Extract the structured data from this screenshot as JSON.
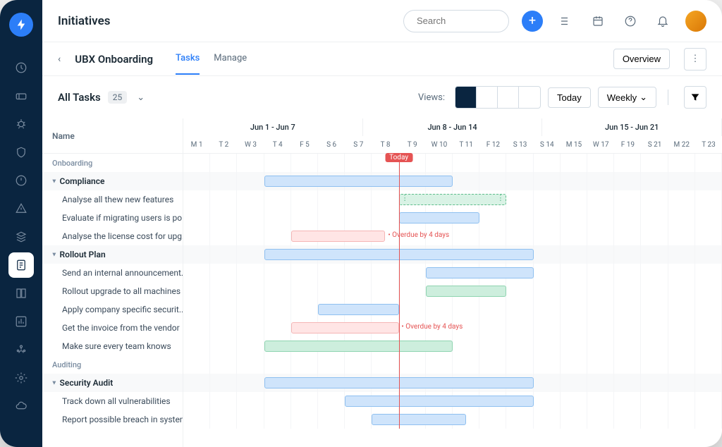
{
  "header": {
    "title": "Initiatives",
    "search_placeholder": "Search"
  },
  "breadcrumb": {
    "project": "UBX Onboarding",
    "tabs": [
      "Tasks",
      "Manage"
    ],
    "active_tab": 0,
    "overview_label": "Overview"
  },
  "toolbar": {
    "all_tasks_label": "All Tasks",
    "count": "25",
    "views_label": "Views:",
    "today_label": "Today",
    "weekly_label": "Weekly"
  },
  "columns": {
    "name": "Name"
  },
  "timeline": {
    "weeks": [
      "Jun 1 - Jun 7",
      "Jun 8 - Jun 14",
      "Jun 15 - Jun 21"
    ],
    "days": [
      "M 1",
      "T 2",
      "W 3",
      "T 4",
      "F 5",
      "S 6",
      "S 7",
      "T 8",
      "T 9",
      "W 10",
      "T 11",
      "F 12",
      "S 13",
      "S 14",
      "M 15",
      "W 17",
      "F 19",
      "S 21",
      "M 22",
      "T 23"
    ],
    "today_label": "Today",
    "today_index": 8
  },
  "sections": [
    {
      "name": "Onboarding",
      "groups": [
        {
          "name": "Compliance",
          "bar": {
            "start": 3,
            "span": 7,
            "type": "blue"
          },
          "tasks": [
            {
              "name": "Analyse all thew new features",
              "bar": {
                "start": 8,
                "span": 4,
                "type": "green-dash"
              }
            },
            {
              "name": "Evaluate if migrating users is po...",
              "bar": {
                "start": 8,
                "span": 3,
                "type": "blue"
              }
            },
            {
              "name": "Analyse the license cost for upg...",
              "bar": {
                "start": 4,
                "span": 3.5,
                "type": "red"
              },
              "overdue": "Overdue by 4 days"
            }
          ]
        },
        {
          "name": "Rollout Plan",
          "bar": {
            "start": 3,
            "span": 10,
            "type": "blue"
          },
          "tasks": [
            {
              "name": "Send an internal announcement...",
              "bar": {
                "start": 9,
                "span": 4,
                "type": "blue"
              }
            },
            {
              "name": "Rollout upgrade to all machines",
              "bar": {
                "start": 9,
                "span": 3,
                "type": "green"
              }
            },
            {
              "name": "Apply company specific securit...",
              "bar": {
                "start": 5,
                "span": 3,
                "type": "blue"
              }
            },
            {
              "name": "Get the invoice from the vendor",
              "bar": {
                "start": 4,
                "span": 4,
                "type": "red"
              },
              "overdue": "Overdue by 4 days"
            },
            {
              "name": "Make sure every team knows",
              "bar": {
                "start": 3,
                "span": 7,
                "type": "green"
              }
            }
          ]
        }
      ]
    },
    {
      "name": "Auditing",
      "groups": [
        {
          "name": "Security Audit",
          "bar": {
            "start": 3,
            "span": 10,
            "type": "blue"
          },
          "tasks": [
            {
              "name": "Track down all vulnerabilities",
              "bar": {
                "start": 6,
                "span": 7,
                "type": "blue"
              }
            },
            {
              "name": "Report possible breach in system",
              "bar": {
                "start": 7,
                "span": 3.5,
                "type": "blue"
              }
            }
          ]
        }
      ]
    }
  ]
}
